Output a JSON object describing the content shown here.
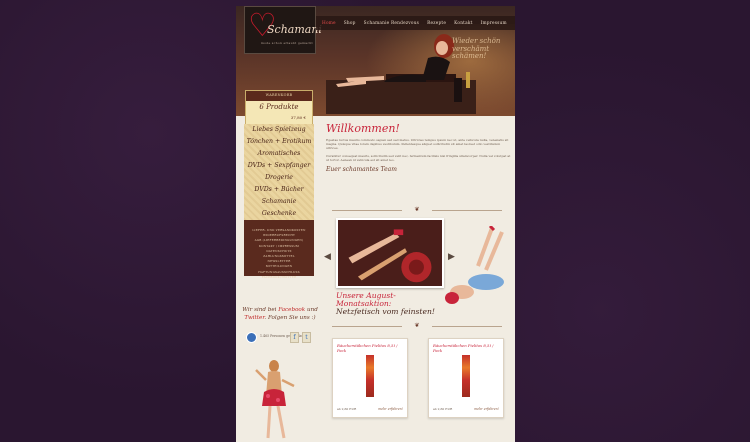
{
  "header": {
    "logo_text": "Schamani",
    "logo_sub": "mode schon erlaubt gemacht",
    "tagline": "Wieder schön verschämt schämen!"
  },
  "nav": {
    "items": [
      {
        "label": "Home",
        "active": true
      },
      {
        "label": "Shop",
        "active": false
      },
      {
        "label": "Schamanie Rendezvous",
        "active": false
      },
      {
        "label": "Rezepte",
        "active": false
      },
      {
        "label": "Kontakt",
        "active": false
      },
      {
        "label": "Impressum",
        "active": false
      }
    ]
  },
  "cart": {
    "title": "WARENKORB",
    "count": "6 Produkte",
    "price": "37,80 €"
  },
  "sidebar": {
    "items": [
      {
        "label": "Liebes Spielzeug"
      },
      {
        "label": "Tönchen + Erotikum"
      },
      {
        "label": "Aromatisches"
      },
      {
        "label": "DVDs + Sexpfanger"
      },
      {
        "label": "Drogerie"
      },
      {
        "label": "DVDs + Bücher"
      },
      {
        "label": "Schamanie Geschenke"
      }
    ],
    "links": [
      "LIEFER- UND VERSANDKOSTEN",
      "WIDERRUFSRECHT",
      "AGB (LIEFERBEDINGUNGEN)",
      "KONTAKT / IMPRESSUM",
      "DATENSCHUTZ",
      "ZAHLUNGSMITTEL",
      "NEWSLETTER",
      "MITTEILUNGEN",
      "HAFTUNGSAUSSCHLUSS",
      "FACEBOOK/TWITTER"
    ]
  },
  "social": {
    "line1a": "Wir sind bei",
    "line1b": "Facebook",
    "line1c": "und",
    "line2a": "Twitter",
    "line2b": ". Folgen Sie uns :)",
    "fb_count": "1.465 Personen gefällt das"
  },
  "main": {
    "welcome": "Willkommen!",
    "para1": "Egestas luctus mauris commodo sapien sed sed metus. Ultricies tempus ipsum nec ut, ante vehicula nulla, venenatis sit magna. Quisque vitae lorem dapibus vestibulum. Pellentesque aliquet sollicitudin sit amet laoreet odio vestibulum ultrices.",
    "para2": "Curabitur consequat mauris, sollicitudin sed velit nec, fermentum facilisis nisi fringilla ullamcorper. Nulla vel volutpat at ut tortor. Aenean id vehicula est sit amet leo.",
    "team": "Euer schamantes Team",
    "promo_line1": "Unsere August-Monatsaktion:",
    "promo_line2": "Netzfetisch vom feinsten!"
  },
  "products": [
    {
      "name": "Räucherstäbchen Pielitos 8,5ℓ / Pack",
      "price": "ab 2,60 EUR",
      "link": "mehr erfahren!"
    },
    {
      "name": "Räucherstäbchen Pielitos 8,5ℓ / Pack",
      "price": "ab 2,60 EUR",
      "link": "mehr erfahren!"
    }
  ],
  "colors": {
    "accent": "#c8243a",
    "background": "#2a1630",
    "content_bg": "#f1ece2",
    "sidebar_dark": "#5a2a1e"
  }
}
